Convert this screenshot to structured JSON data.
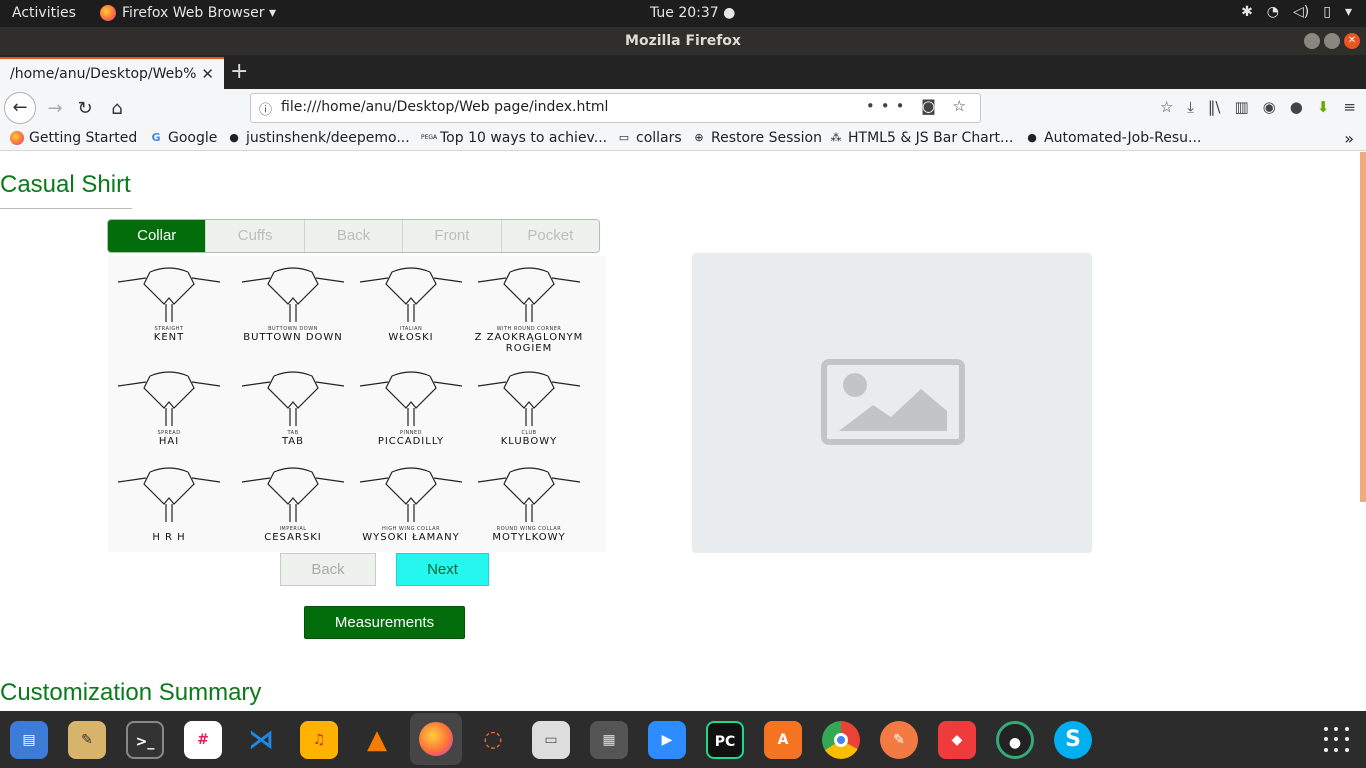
{
  "system": {
    "activities": "Activities",
    "app_menu": "Firefox Web Browser ▾",
    "clock": "Tue 20:37 ●"
  },
  "window": {
    "title": "Mozilla Firefox"
  },
  "tab": {
    "label": "/home/anu/Desktop/Web%"
  },
  "urlbar": {
    "value": "file:///home/anu/Desktop/Web page/index.html"
  },
  "bookmarks": [
    {
      "label": "Getting Started",
      "icon": "firefox-icon"
    },
    {
      "label": "Google",
      "icon": "google-icon"
    },
    {
      "label": "justinshenk/deepemo...",
      "icon": "github-icon"
    },
    {
      "label": "Top 10 ways to achiev...",
      "icon": "pega-icon"
    },
    {
      "label": "collars",
      "icon": "folder-icon"
    },
    {
      "label": "Restore Session",
      "icon": "globe-icon"
    },
    {
      "label": "HTML5 & JS Bar Chart...",
      "icon": "chart-icon"
    },
    {
      "label": "Automated-Job-Resu...",
      "icon": "github-icon"
    }
  ],
  "page": {
    "title": "Casual Shirt",
    "steps": [
      "Collar",
      "Cuffs",
      "Back",
      "Front",
      "Pocket"
    ],
    "active_step": "Collar",
    "back_label": "Back",
    "next_label": "Next",
    "measurements_label": "Measurements",
    "summary_title": "Customization Summary"
  },
  "collars": [
    {
      "sub": "STRAIGHT",
      "name": "KENT"
    },
    {
      "sub": "BUTTOWN DOWN",
      "name": "BUTTOWN DOWN"
    },
    {
      "sub": "ITALIAN",
      "name": "WŁOSKI"
    },
    {
      "sub": "WITH ROUND CORNER",
      "name": "Z ZAOKRĄGLONYM ROGIEM"
    },
    {
      "sub": "SPREAD",
      "name": "HAI"
    },
    {
      "sub": "TAB",
      "name": "TAB"
    },
    {
      "sub": "PINNED",
      "name": "PICCADILLY"
    },
    {
      "sub": "CLUB",
      "name": "KLUBOWY"
    },
    {
      "sub": "",
      "name": "H R H"
    },
    {
      "sub": "IMPERIAL",
      "name": "CESARSKI"
    },
    {
      "sub": "HIGH WING COLLAR",
      "name": "WYSOKI ŁAMANY"
    },
    {
      "sub": "ROUND WING COLLAR",
      "name": "MOTYLKOWY"
    }
  ],
  "colors": {
    "primary_green": "#046d0b",
    "title_green": "#0a7a1a",
    "next_cyan": "#25f7ee"
  }
}
